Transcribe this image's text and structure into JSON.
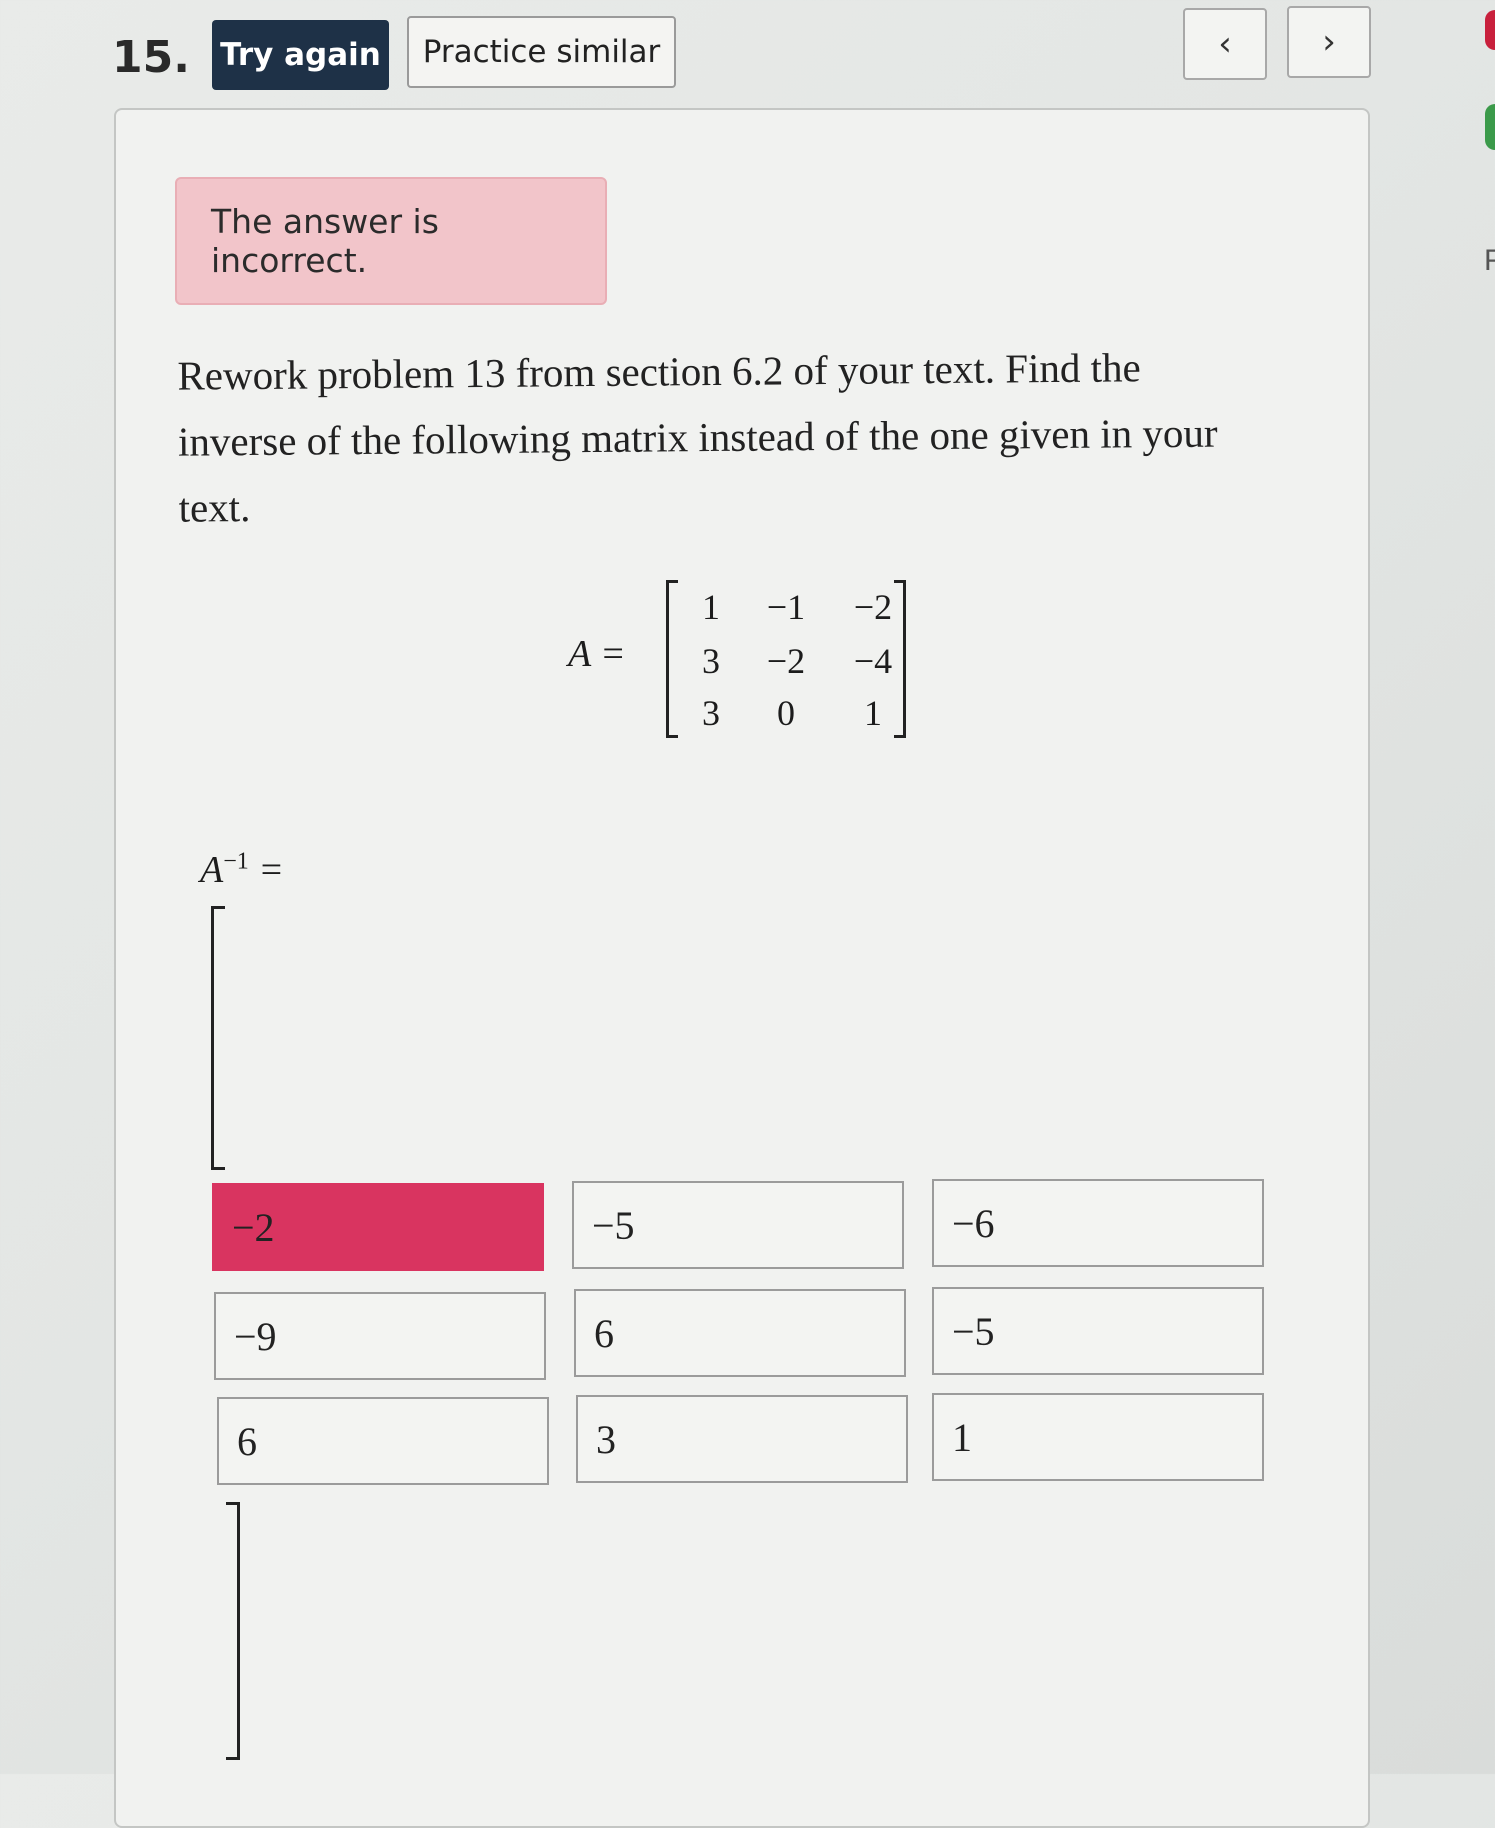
{
  "header": {
    "question_number": "15.",
    "try_again_label": "Try again",
    "practice_label": "Practice similar",
    "prev_icon": "‹",
    "next_icon": "›"
  },
  "alert": {
    "text": "The answer is incorrect."
  },
  "problem": {
    "text": "Rework problem 13 from section 6.2 of your text. Find the inverse of the following matrix instead of the one given in your text."
  },
  "matrix_A": {
    "label": "A =",
    "rows": [
      [
        "1",
        "−1",
        "−2"
      ],
      [
        "3",
        "−2",
        "−4"
      ],
      [
        "3",
        "0",
        "1"
      ]
    ]
  },
  "inverse": {
    "label": "A",
    "exponent": "−1",
    "equals": " =",
    "answers": [
      [
        "−2",
        "−5",
        "−6"
      ],
      [
        "−9",
        "6",
        "−5"
      ],
      [
        "6",
        "3",
        "1"
      ]
    ],
    "incorrect_cell": "row 1, column 1"
  },
  "edge": {
    "letter": "F"
  }
}
